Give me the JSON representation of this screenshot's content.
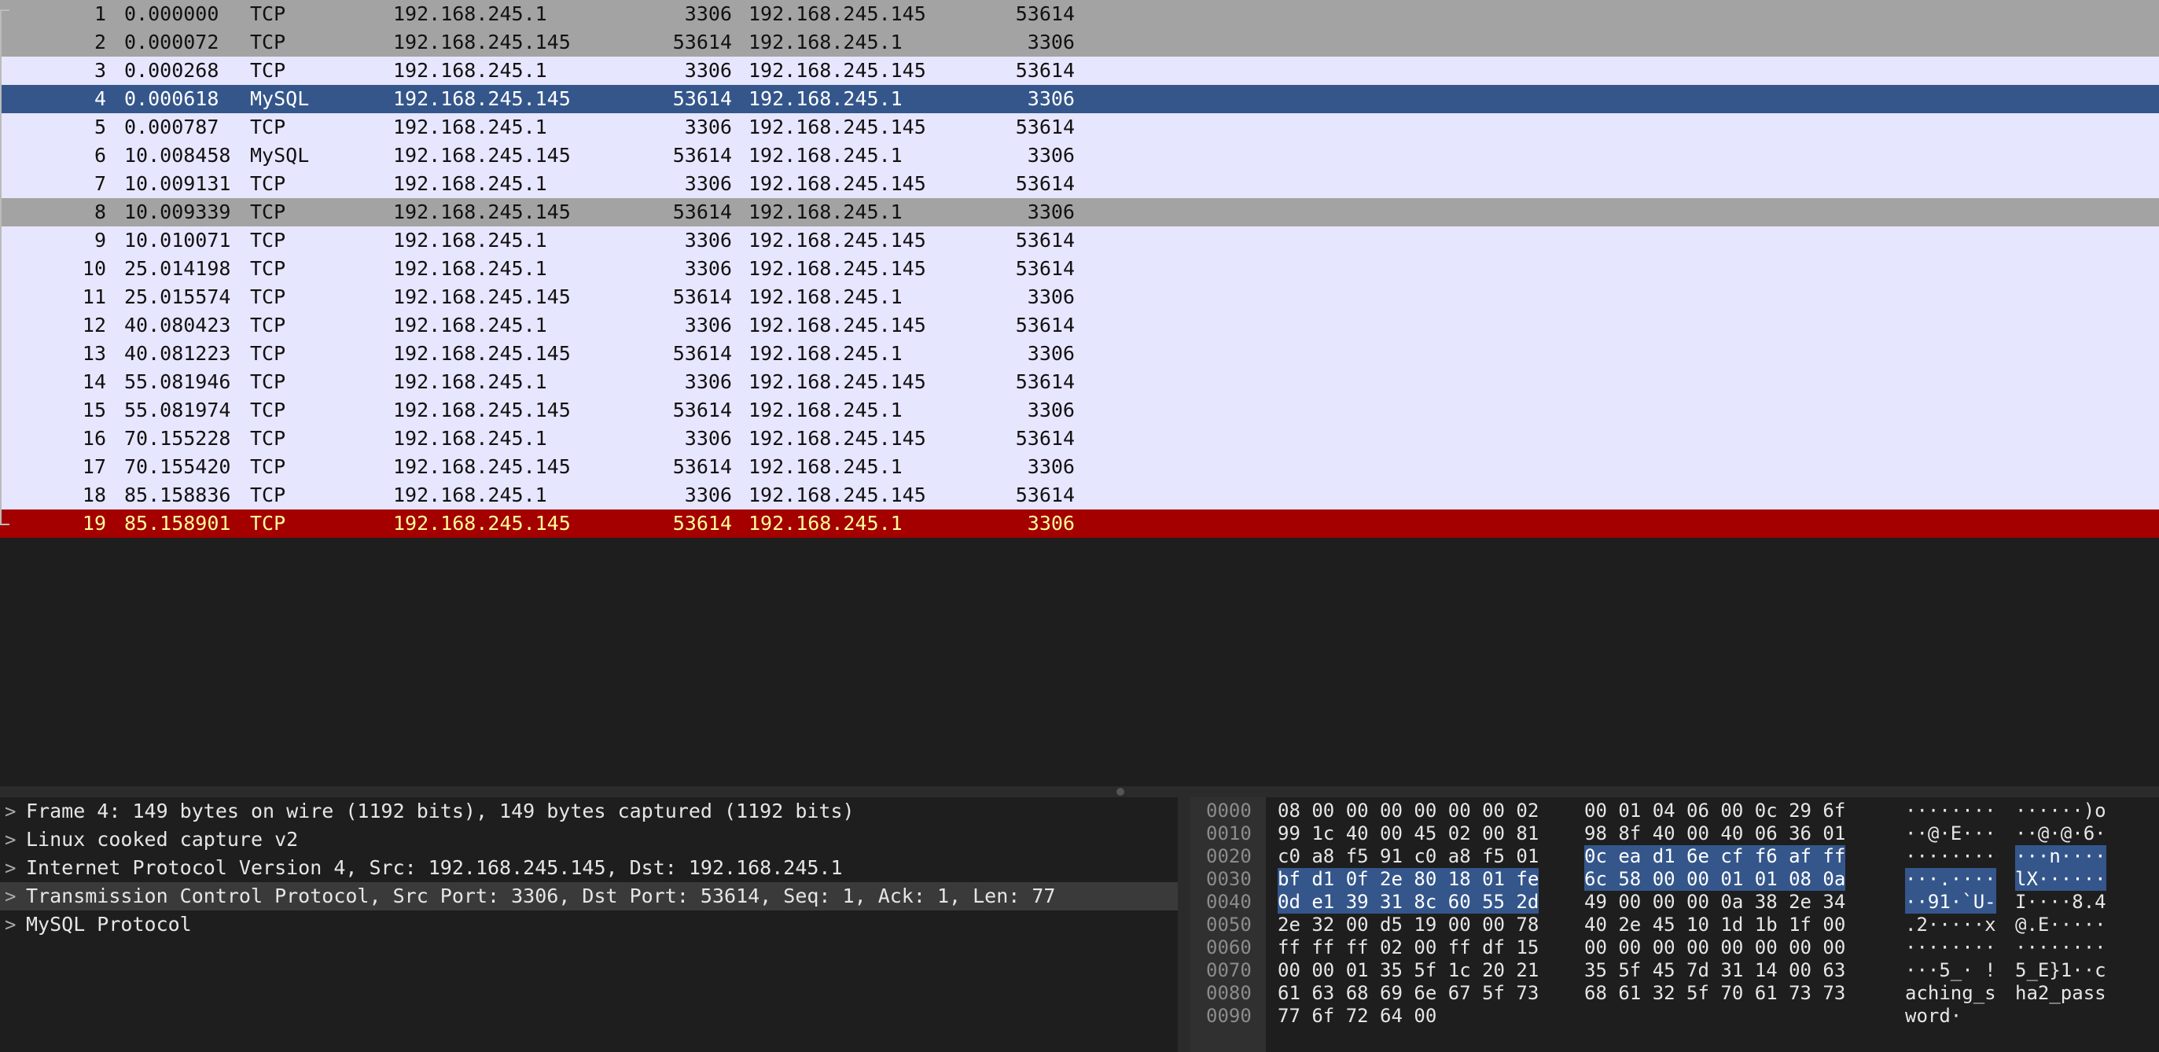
{
  "packets": [
    {
      "no": "1",
      "time": "0.000000",
      "proto": "TCP",
      "src": "192.168.245.1",
      "sport": "3306",
      "dst": "192.168.245.145",
      "dport": "53614",
      "bg": "#a3a3a3",
      "fg": "#111111"
    },
    {
      "no": "2",
      "time": "0.000072",
      "proto": "TCP",
      "src": "192.168.245.145",
      "sport": "53614",
      "dst": "192.168.245.1",
      "dport": "3306",
      "bg": "#a3a3a3",
      "fg": "#111111"
    },
    {
      "no": "3",
      "time": "0.000268",
      "proto": "TCP",
      "src": "192.168.245.1",
      "sport": "3306",
      "dst": "192.168.245.145",
      "dport": "53614",
      "bg": "#e7e6ff",
      "fg": "#111111"
    },
    {
      "no": "4",
      "time": "0.000618",
      "proto": "MySQL",
      "src": "192.168.245.145",
      "sport": "53614",
      "dst": "192.168.245.1",
      "dport": "3306",
      "bg": "#34568b",
      "fg": "#ffffff"
    },
    {
      "no": "5",
      "time": "0.000787",
      "proto": "TCP",
      "src": "192.168.245.1",
      "sport": "3306",
      "dst": "192.168.245.145",
      "dport": "53614",
      "bg": "#e7e6ff",
      "fg": "#111111"
    },
    {
      "no": "6",
      "time": "10.008458",
      "proto": "MySQL",
      "src": "192.168.245.145",
      "sport": "53614",
      "dst": "192.168.245.1",
      "dport": "3306",
      "bg": "#e7e6ff",
      "fg": "#111111"
    },
    {
      "no": "7",
      "time": "10.009131",
      "proto": "TCP",
      "src": "192.168.245.1",
      "sport": "3306",
      "dst": "192.168.245.145",
      "dport": "53614",
      "bg": "#e7e6ff",
      "fg": "#111111"
    },
    {
      "no": "8",
      "time": "10.009339",
      "proto": "TCP",
      "src": "192.168.245.145",
      "sport": "53614",
      "dst": "192.168.245.1",
      "dport": "3306",
      "bg": "#a3a3a3",
      "fg": "#111111"
    },
    {
      "no": "9",
      "time": "10.010071",
      "proto": "TCP",
      "src": "192.168.245.1",
      "sport": "3306",
      "dst": "192.168.245.145",
      "dport": "53614",
      "bg": "#e7e6ff",
      "fg": "#111111"
    },
    {
      "no": "10",
      "time": "25.014198",
      "proto": "TCP",
      "src": "192.168.245.1",
      "sport": "3306",
      "dst": "192.168.245.145",
      "dport": "53614",
      "bg": "#e7e6ff",
      "fg": "#111111"
    },
    {
      "no": "11",
      "time": "25.015574",
      "proto": "TCP",
      "src": "192.168.245.145",
      "sport": "53614",
      "dst": "192.168.245.1",
      "dport": "3306",
      "bg": "#e7e6ff",
      "fg": "#111111"
    },
    {
      "no": "12",
      "time": "40.080423",
      "proto": "TCP",
      "src": "192.168.245.1",
      "sport": "3306",
      "dst": "192.168.245.145",
      "dport": "53614",
      "bg": "#e7e6ff",
      "fg": "#111111"
    },
    {
      "no": "13",
      "time": "40.081223",
      "proto": "TCP",
      "src": "192.168.245.145",
      "sport": "53614",
      "dst": "192.168.245.1",
      "dport": "3306",
      "bg": "#e7e6ff",
      "fg": "#111111"
    },
    {
      "no": "14",
      "time": "55.081946",
      "proto": "TCP",
      "src": "192.168.245.1",
      "sport": "3306",
      "dst": "192.168.245.145",
      "dport": "53614",
      "bg": "#e7e6ff",
      "fg": "#111111"
    },
    {
      "no": "15",
      "time": "55.081974",
      "proto": "TCP",
      "src": "192.168.245.145",
      "sport": "53614",
      "dst": "192.168.245.1",
      "dport": "3306",
      "bg": "#e7e6ff",
      "fg": "#111111"
    },
    {
      "no": "16",
      "time": "70.155228",
      "proto": "TCP",
      "src": "192.168.245.1",
      "sport": "3306",
      "dst": "192.168.245.145",
      "dport": "53614",
      "bg": "#e7e6ff",
      "fg": "#111111"
    },
    {
      "no": "17",
      "time": "70.155420",
      "proto": "TCP",
      "src": "192.168.245.145",
      "sport": "53614",
      "dst": "192.168.245.1",
      "dport": "3306",
      "bg": "#e7e6ff",
      "fg": "#111111"
    },
    {
      "no": "18",
      "time": "85.158836",
      "proto": "TCP",
      "src": "192.168.245.1",
      "sport": "3306",
      "dst": "192.168.245.145",
      "dport": "53614",
      "bg": "#e7e6ff",
      "fg": "#111111"
    },
    {
      "no": "19",
      "time": "85.158901",
      "proto": "TCP",
      "src": "192.168.245.145",
      "sport": "53614",
      "dst": "192.168.245.1",
      "dport": "3306",
      "bg": "#a40000",
      "fg": "#fffc9c"
    }
  ],
  "details": [
    {
      "chevron": ">",
      "text": "Frame 4: 149 bytes on wire (1192 bits), 149 bytes captured (1192 bits)",
      "highlight": false
    },
    {
      "chevron": ">",
      "text": "Linux cooked capture v2",
      "highlight": false
    },
    {
      "chevron": ">",
      "text": "Internet Protocol Version 4, Src: 192.168.245.145, Dst: 192.168.245.1",
      "highlight": false
    },
    {
      "chevron": ">",
      "text": "Transmission Control Protocol, Src Port: 3306, Dst Port: 53614, Seq: 1, Ack: 1, Len: 77",
      "highlight": true
    },
    {
      "chevron": ">",
      "text": "MySQL Protocol",
      "highlight": false
    }
  ],
  "bytes": [
    {
      "offset": "0000",
      "h1": "08 00 00 00 00 00 00 02",
      "h2": "00 01 04 06 00 0c 29 6f",
      "a1": "········",
      "a2": "······)o",
      "hl1": "",
      "hl2": "",
      "ahl1": "",
      "ahl2": ""
    },
    {
      "offset": "0010",
      "h1": "99 1c 40 00 45 02 00 81",
      "h2": "98 8f 40 00 40 06 36 01",
      "a1": "··@·E···",
      "a2": "··@·@·6·",
      "hl1": "",
      "hl2": "",
      "ahl1": "",
      "ahl2": ""
    },
    {
      "offset": "0020",
      "h1": "c0 a8 f5 91 c0 a8 f5 01",
      "h2": "",
      "a1": "········",
      "a2": "",
      "hl1": "",
      "hl2": "0c ea d1 6e cf f6 af ff",
      "ahl1": "",
      "ahl2": "···n····"
    },
    {
      "offset": "0030",
      "h1": "",
      "h2": "",
      "a1": "",
      "a2": "",
      "hl1": "bf d1 0f 2e 80 18 01 fe",
      "hl2": "6c 58 00 00 01 01 08 0a",
      "ahl1": "···.····",
      "ahl2": "lX······"
    },
    {
      "offset": "0040",
      "h1": "",
      "h2": "49 00 00 00 0a 38 2e 34",
      "a1": "",
      "a2": "I····8.4",
      "hl1": "0d e1 39 31 8c 60 55 2d",
      "hl2": "",
      "ahl1": "··91·`U-",
      "ahl2": ""
    },
    {
      "offset": "0050",
      "h1": "2e 32 00 d5 19 00 00 78",
      "h2": "40 2e 45 10 1d 1b 1f 00",
      "a1": ".2·····x",
      "a2": "@.E·····",
      "hl1": "",
      "hl2": "",
      "ahl1": "",
      "ahl2": ""
    },
    {
      "offset": "0060",
      "h1": "ff ff ff 02 00 ff df 15",
      "h2": "00 00 00 00 00 00 00 00",
      "a1": "········",
      "a2": "········",
      "hl1": "",
      "hl2": "",
      "ahl1": "",
      "ahl2": ""
    },
    {
      "offset": "0070",
      "h1": "00 00 01 35 5f 1c 20 21",
      "h2": "35 5f 45 7d 31 14 00 63",
      "a1": "···5_· !",
      "a2": "5_E}1··c",
      "hl1": "",
      "hl2": "",
      "ahl1": "",
      "ahl2": ""
    },
    {
      "offset": "0080",
      "h1": "61 63 68 69 6e 67 5f 73",
      "h2": "68 61 32 5f 70 61 73 73",
      "a1": "aching_s",
      "a2": "ha2_pass",
      "hl1": "",
      "hl2": "",
      "ahl1": "",
      "ahl2": ""
    },
    {
      "offset": "0090",
      "h1": "77 6f 72 64 00",
      "h2": "",
      "a1": "word·",
      "a2": "",
      "hl1": "",
      "hl2": "",
      "ahl1": "",
      "ahl2": ""
    }
  ]
}
